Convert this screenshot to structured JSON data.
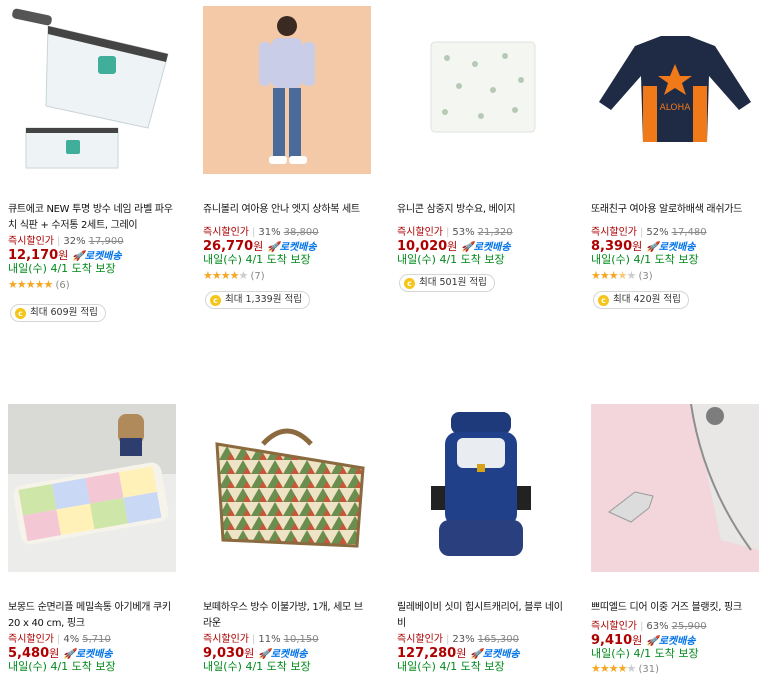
{
  "products": [
    {
      "title": "큐트에코 NEW 투명 방수 네임 라벨 파우치 식판 + 수저통 2세트, 그레이",
      "badge": "즉시할인가",
      "discount": "32%",
      "original_price": "17,900",
      "price": "12,170",
      "currency": "원",
      "rocket": "로켓배송",
      "delivery": "내일(수) 4/1 도착 보장",
      "rating": 4.5,
      "stars_text": "★★★★★",
      "review_count": "(6)",
      "reward": "최대 609원 적립",
      "image": "clear-pouch"
    },
    {
      "title": "쥬니볼리 여아용 안나 엣지 상하복 세트",
      "badge": "즉시할인가",
      "discount": "31%",
      "original_price": "38,800",
      "price": "26,770",
      "currency": "원",
      "rocket": "로켓배송",
      "delivery": "내일(수) 4/1 도착 보장",
      "rating": 4,
      "stars_text": "★★★★★",
      "review_count": "(7)",
      "reward": "최대 1,339원 적립",
      "image": "girl-outfit"
    },
    {
      "title": "유니콘 삼중지 방수요, 베이지",
      "badge": "즉시할인가",
      "discount": "53%",
      "original_price": "21,320",
      "price": "10,020",
      "currency": "원",
      "rocket": "로켓배송",
      "delivery": "내일(수) 4/1 도착 보장",
      "rating": null,
      "stars_text": "",
      "review_count": "",
      "reward": "최대 501원 적립",
      "image": "waterproof-mat"
    },
    {
      "title": "또래친구 여아용 알로하배색 래쉬가드",
      "badge": "즉시할인가",
      "discount": "52%",
      "original_price": "17,480",
      "price": "8,390",
      "currency": "원",
      "rocket": "로켓배송",
      "delivery": "내일(수) 4/1 도착 보장",
      "rating": 3.5,
      "stars_text": "★★★★★",
      "review_count": "(3)",
      "reward": "최대 420원 적립",
      "image": "rash-guard"
    },
    {
      "title": "보몽드 순면리플 메밀속통 아기베개 쿠키 20 x 40 cm, 핑크",
      "badge": "즉시할인가",
      "discount": "4%",
      "original_price": "5,710",
      "price": "5,480",
      "currency": "원",
      "rocket": "로켓배송",
      "delivery": "내일(수) 4/1 도착 보장",
      "image": "baby-pillow"
    },
    {
      "title": "보떼하우스 방수 이불가방, 1개, 세모 브라운",
      "badge": "즉시할인가",
      "discount": "11%",
      "original_price": "10,150",
      "price": "9,030",
      "currency": "원",
      "rocket": "로켓배송",
      "delivery": "내일(수) 4/1 도착 보장",
      "image": "blanket-bag"
    },
    {
      "title": "릴레베이비 싯미 힙시트캐리어, 블루 네이비",
      "badge": "즉시할인가",
      "discount": "23%",
      "original_price": "165,300",
      "price": "127,280",
      "currency": "원",
      "rocket": "로켓배송",
      "delivery": "내일(수) 4/1 도착 보장",
      "image": "baby-carrier"
    },
    {
      "title": "쁘띠엘드 디어 이중 거즈 블랭킷, 핑크",
      "badge": "즉시할인가",
      "discount": "63%",
      "original_price": "25,900",
      "price": "9,410",
      "currency": "원",
      "rocket": "로켓배송",
      "delivery": "내일(수) 4/1 도착 보장",
      "rating": 4,
      "stars_text": "★★★★★",
      "review_count": "(31)",
      "image": "gauze-blanket"
    }
  ],
  "colors": {
    "price_red": "#ae0000",
    "rocket_blue": "#0073e9",
    "delivery_green": "#00891a",
    "star_gold": "#f5a623"
  }
}
